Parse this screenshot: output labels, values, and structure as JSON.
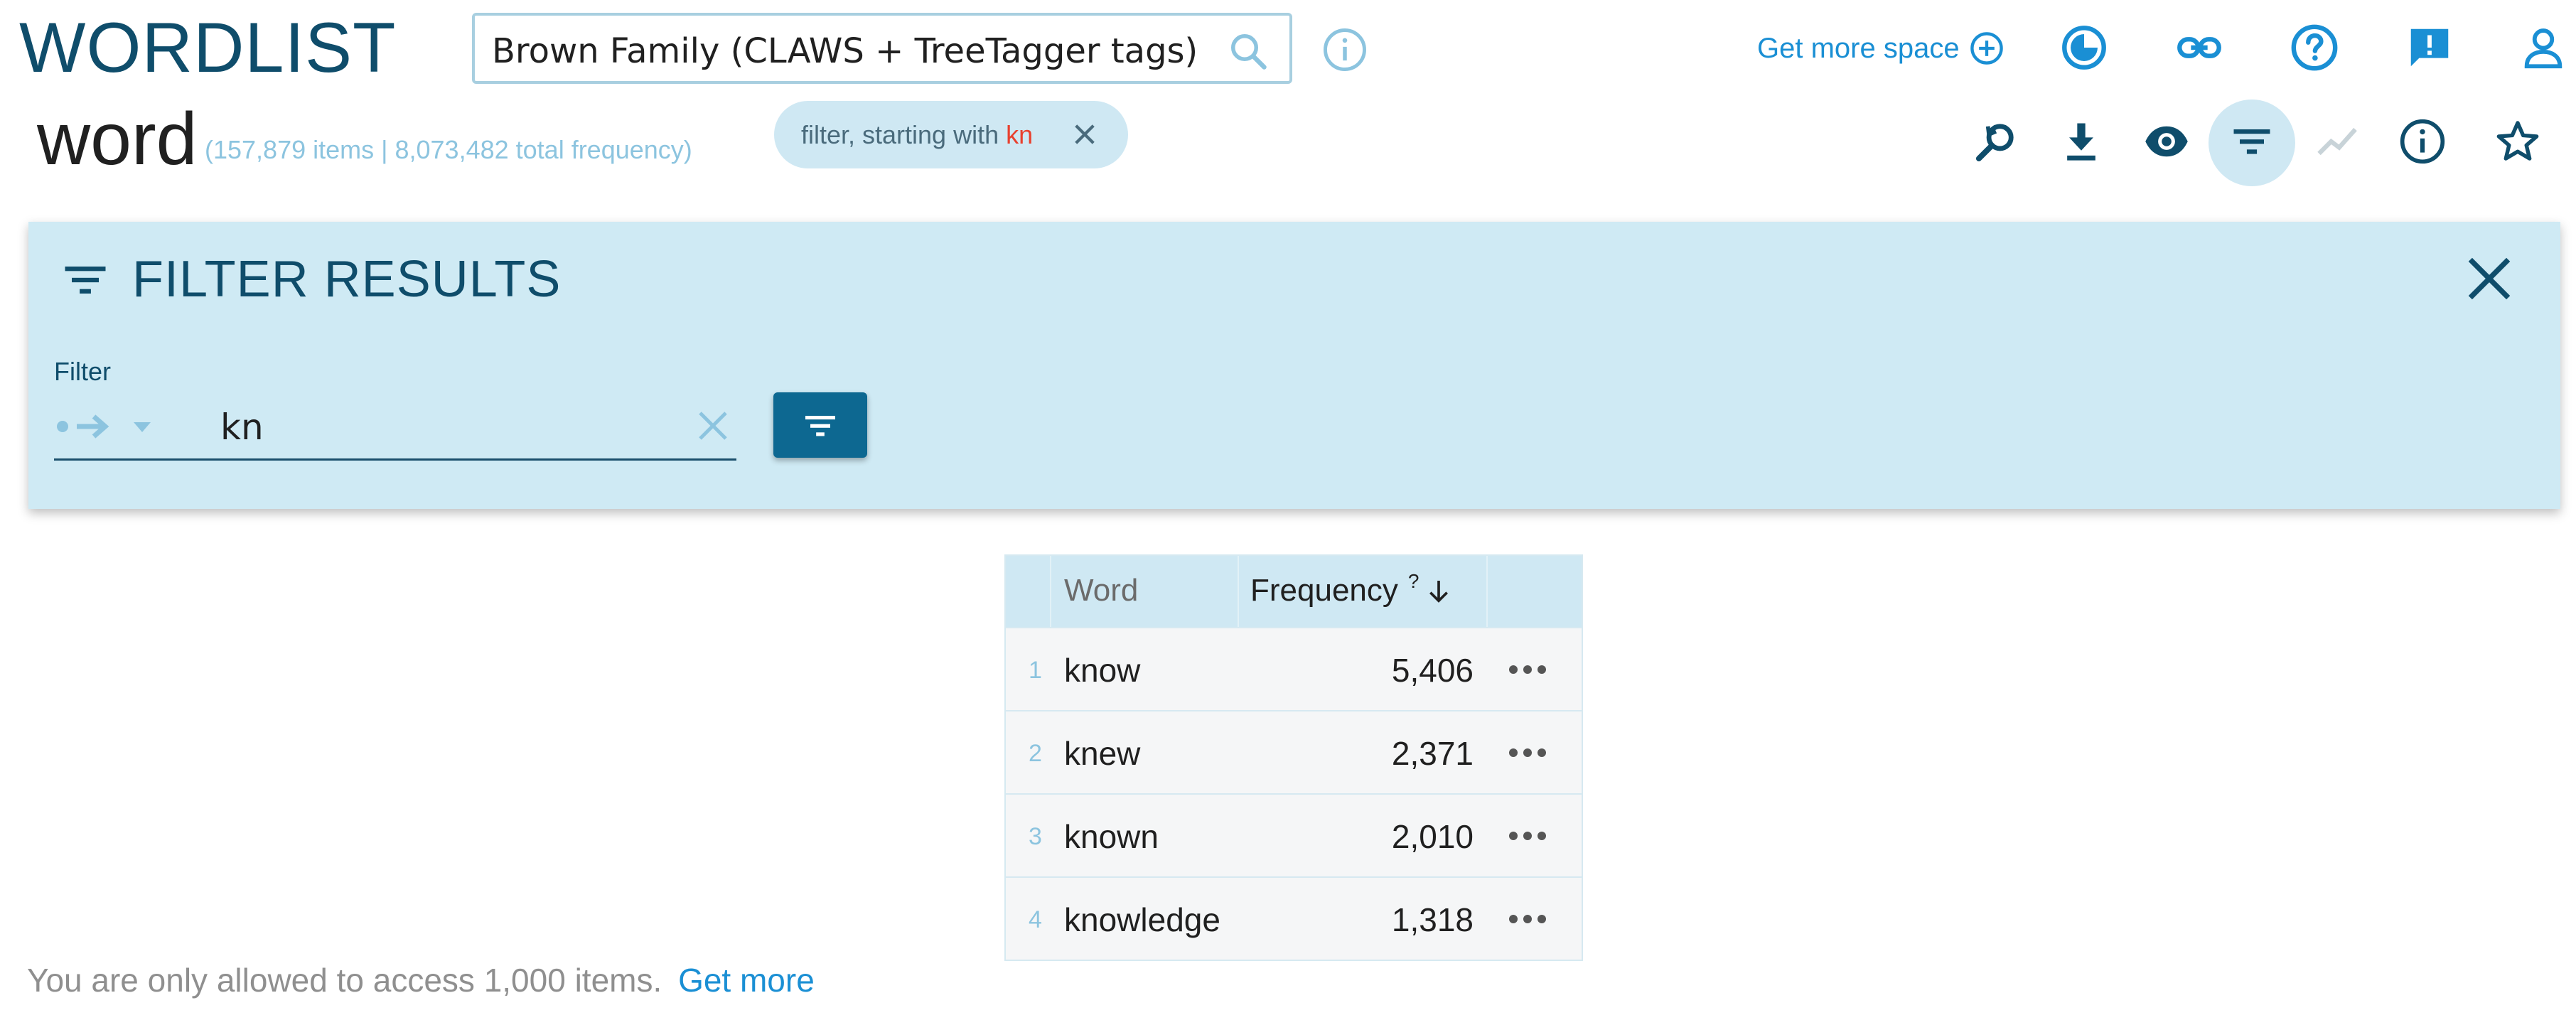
{
  "header": {
    "app_title": "WORDLIST",
    "corpus": "Brown Family (CLAWS + TreeTagger tags)",
    "get_more_space": "Get more space"
  },
  "subheader": {
    "attribute": "word",
    "stats": "(157,879 items | 8,073,482 total frequency)",
    "filter_chip": {
      "prefix": "filter, starting with",
      "value": "kn"
    }
  },
  "filter_panel": {
    "title": "FILTER RESULTS",
    "field_label": "Filter",
    "value": "kn"
  },
  "table": {
    "columns": {
      "word": "Word",
      "frequency": "Frequency",
      "frequency_hint": "?"
    },
    "rows": [
      {
        "num": "1",
        "word": "know",
        "frequency": "5,406"
      },
      {
        "num": "2",
        "word": "knew",
        "frequency": "2,371"
      },
      {
        "num": "3",
        "word": "known",
        "frequency": "2,010"
      },
      {
        "num": "4",
        "word": "knowledge",
        "frequency": "1,318"
      }
    ]
  },
  "footer": {
    "note": "You are only allowed to access 1,000 items.",
    "link": "Get more"
  },
  "colors": {
    "brand": "#0f4d6b",
    "accent": "#1a8fd4",
    "panel_bg": "#cfeaf4",
    "highlight": "#e8402e"
  }
}
